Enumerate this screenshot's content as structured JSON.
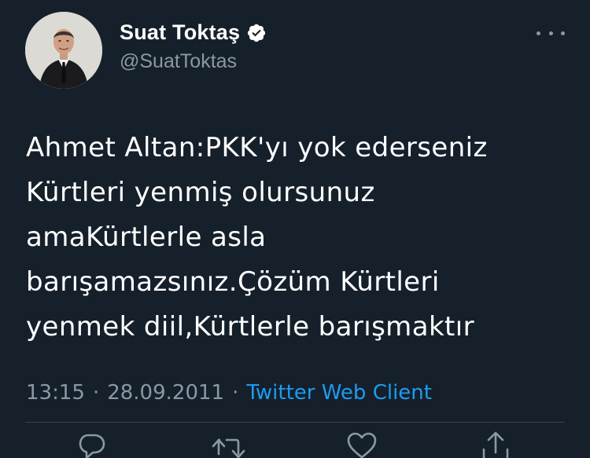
{
  "author": {
    "display_name": "Suat Toktaş",
    "handle": "@SuatToktas",
    "verified": true
  },
  "tweet": {
    "lines": [
      "Ahmet Altan:PKK'yı yok ederseniz",
      "Kürtleri yenmiş olursunuz",
      "amaKürtlerle asla",
      "barışamazsınız.Çözüm Kürtleri",
      "yenmek diil,Kürtlerle barışmaktır"
    ],
    "time": "13:15",
    "separator": "·",
    "date": "28.09.2011",
    "source": "Twitter Web Client"
  },
  "icons": {
    "more": "more-horizontal-icon",
    "verified": "verified-badge-icon",
    "reply": "reply-icon",
    "retweet": "retweet-icon",
    "like": "heart-icon",
    "share": "share-icon"
  },
  "colors": {
    "background": "#15202b",
    "secondary_text": "#8b98a5",
    "link": "#1d9bf0",
    "verified_badge": "#ffffff"
  }
}
